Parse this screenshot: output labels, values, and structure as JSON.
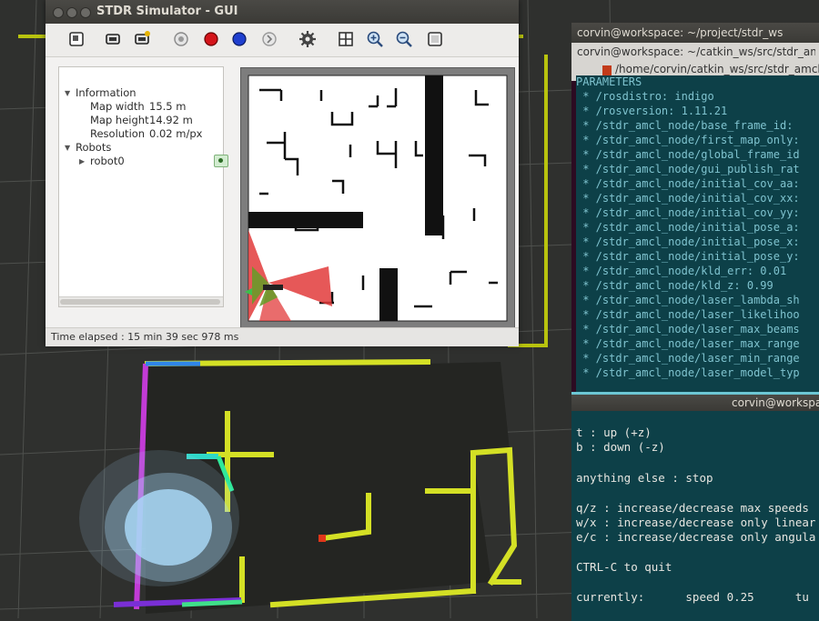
{
  "stdr": {
    "title": "STDR Simulator - GUI",
    "tree": {
      "information": "Information",
      "map_width_label": "Map width",
      "map_width_value": "15.5 m",
      "map_height_label": "Map height",
      "map_height_value": "14.92 m",
      "resolution_label": "Resolution",
      "resolution_value": "0.02 m/px",
      "robots": "Robots",
      "robot0": "robot0"
    },
    "status": "Time elapsed : 15 min 39 sec 978 ms",
    "toolbar_icons": [
      "load-map-icon",
      "add-robot-icon",
      "add-robot-plus-icon",
      "add-rfid-icon",
      "add-co2-icon",
      "add-thermal-icon",
      "add-sound-icon",
      "settings-icon",
      "grid-icon",
      "zoom-in-icon",
      "zoom-out-icon",
      "fit-icon"
    ]
  },
  "terminal1": {
    "title": "corvin@workspace: ~/project/stdr_ws",
    "tab1": "corvin@workspace: ~/catkin_ws/src/stdr_amcl",
    "tab2": "/home/corvin/catkin_ws/src/stdr_amcl/lau",
    "lines": [
      "PARAMETERS",
      " * /rosdistro: indigo",
      " * /rosversion: 1.11.21",
      " * /stdr_amcl_node/base_frame_id: ",
      " * /stdr_amcl_node/first_map_only:",
      " * /stdr_amcl_node/global_frame_id",
      " * /stdr_amcl_node/gui_publish_rat",
      " * /stdr_amcl_node/initial_cov_aa:",
      " * /stdr_amcl_node/initial_cov_xx:",
      " * /stdr_amcl_node/initial_cov_yy:",
      " * /stdr_amcl_node/initial_pose_a:",
      " * /stdr_amcl_node/initial_pose_x:",
      " * /stdr_amcl_node/initial_pose_y:",
      " * /stdr_amcl_node/kld_err: 0.01",
      " * /stdr_amcl_node/kld_z: 0.99",
      " * /stdr_amcl_node/laser_lambda_sh",
      " * /stdr_amcl_node/laser_likelihoo",
      " * /stdr_amcl_node/laser_max_beams",
      " * /stdr_amcl_node/laser_max_range",
      " * /stdr_amcl_node/laser_min_range",
      " * /stdr_amcl_node/laser_model_typ"
    ]
  },
  "terminal2": {
    "title": "corvin@workspace",
    "lines": [
      "t : up (+z)",
      "b : down (-z)",
      "",
      "anything else : stop",
      "",
      "q/z : increase/decrease max speeds",
      "w/x : increase/decrease only linear",
      "e/c : increase/decrease only angula",
      "",
      "CTRL-C to quit",
      "",
      "currently:      speed 0.25      tu"
    ]
  },
  "colors": {
    "rviz_bg": "#2f302e",
    "map_wall": "#d4e025",
    "particle": "#a9d8f5",
    "terminal_bg": "#0d4048",
    "terminal_text": "#7fc3cf"
  }
}
